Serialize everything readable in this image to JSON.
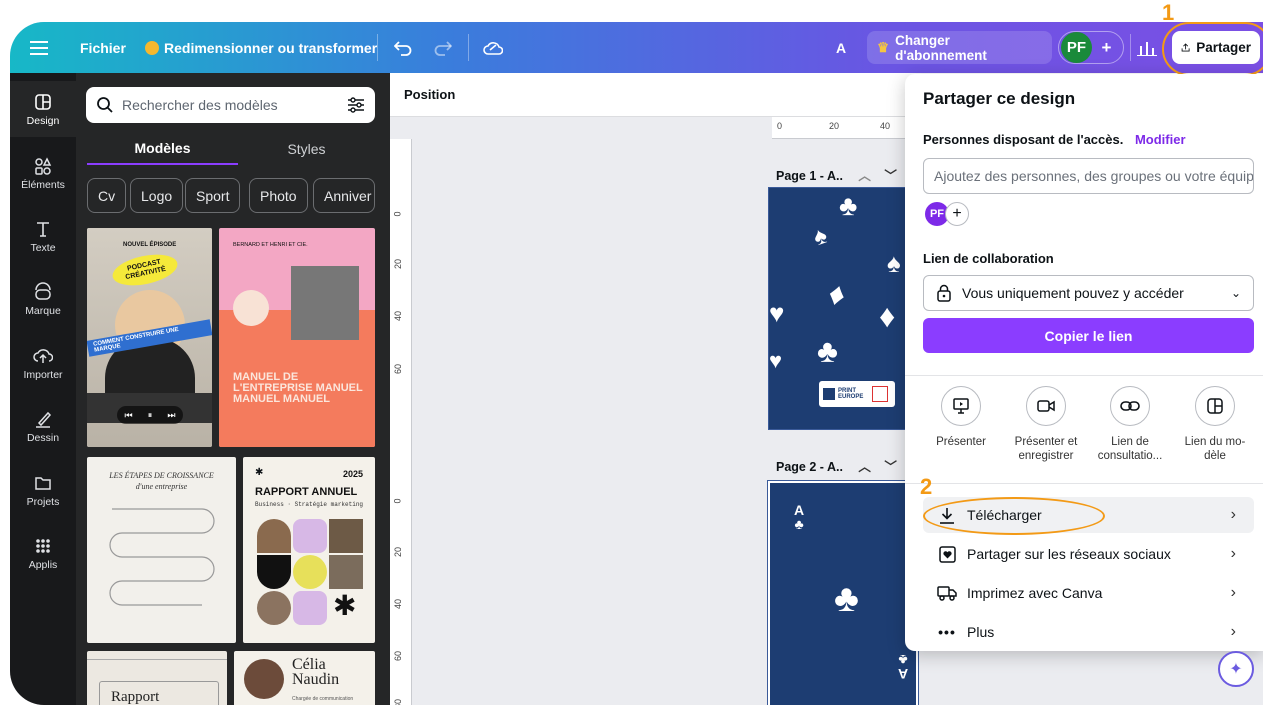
{
  "topbar": {
    "file_label": "Fichier",
    "resize_label": "Redimensionner ou transformer",
    "text_a": "A",
    "upgrade_label": "Changer d'abonnement",
    "avatar_initials": "PF",
    "share_label": "Partager"
  },
  "rail": [
    {
      "label": "Design",
      "icon": "design-icon"
    },
    {
      "label": "Éléments",
      "icon": "elements-icon"
    },
    {
      "label": "Texte",
      "icon": "text-icon"
    },
    {
      "label": "Marque",
      "icon": "brand-icon"
    },
    {
      "label": "Importer",
      "icon": "upload-icon"
    },
    {
      "label": "Dessin",
      "icon": "draw-icon"
    },
    {
      "label": "Projets",
      "icon": "folder-icon"
    },
    {
      "label": "Applis",
      "icon": "apps-icon"
    }
  ],
  "panel": {
    "search_placeholder": "Rechercher des modèles",
    "tabs": [
      "Modèles",
      "Styles"
    ],
    "chips": [
      "Cv",
      "Logo",
      "Sport",
      "Photo",
      "Anniver"
    ],
    "templates": {
      "podcast_episode": "NOUVEL ÉPISODE",
      "podcast_title": "PODCAST CRÉATIVITÉ",
      "podcast_sub": "COMMENT CONSTRUIRE UNE MARQUE",
      "manual_header": "BERNARD ET HENRI ET CIE.",
      "manual_title": "MANUEL DE L'ENTREPRISE MANUEL MANUEL MANUEL",
      "growth_title": "LES ÉTAPES DE CROISSANCE",
      "growth_sub": "d'une entreprise",
      "report_year": "2025",
      "report_title": "RAPPORT ANNUEL",
      "report_sub": "Business · Stratégie marketing",
      "rapport_title": "Rapport",
      "celia_name": "Célia Naudin",
      "celia_sub": "Chargée de communication"
    }
  },
  "canvas": {
    "toolbar_position": "Position",
    "ruler_top": [
      "0",
      "20",
      "40"
    ],
    "ruler_left": [
      "0",
      "20",
      "40",
      "60"
    ],
    "ruler_left2": [
      "0",
      "20",
      "40",
      "60",
      "80"
    ],
    "page1_label": "Page 1 - A..",
    "page2_label": "Page 2 - A..",
    "card_rank": "A",
    "badge_text": "PRINT EUROPE"
  },
  "share": {
    "title": "Partager ce design",
    "access_label": "Personnes disposant de l'accès.",
    "modify_label": "Modifier",
    "add_people_placeholder": "Ajoutez des personnes, des groupes ou votre équipe",
    "avatar_initials": "PF",
    "collab_link_label": "Lien de collaboration",
    "access_select_value": "Vous uniquement pouvez y accéder",
    "copy_link_label": "Copier le lien",
    "quick_actions": [
      {
        "label": "Présenter",
        "icon": "present-icon"
      },
      {
        "label": "Présenter et enregistrer",
        "icon": "record-icon"
      },
      {
        "label": "Lien de consultatio...",
        "icon": "link-icon"
      },
      {
        "label": "Lien du mo-dèle",
        "icon": "template-icon"
      }
    ],
    "menu": [
      {
        "label": "Télécharger",
        "icon": "download-icon"
      },
      {
        "label": "Partager sur les réseaux sociaux",
        "icon": "heart-icon"
      },
      {
        "label": "Imprimez avec Canva",
        "icon": "truck-icon"
      },
      {
        "label": "Plus",
        "icon": "more-icon"
      }
    ]
  },
  "annotations": {
    "step1": "1",
    "step2": "2"
  },
  "colors": {
    "accent": "#7d2ae8",
    "annotation": "#f39a16",
    "card_blue": "#1d3d72"
  }
}
